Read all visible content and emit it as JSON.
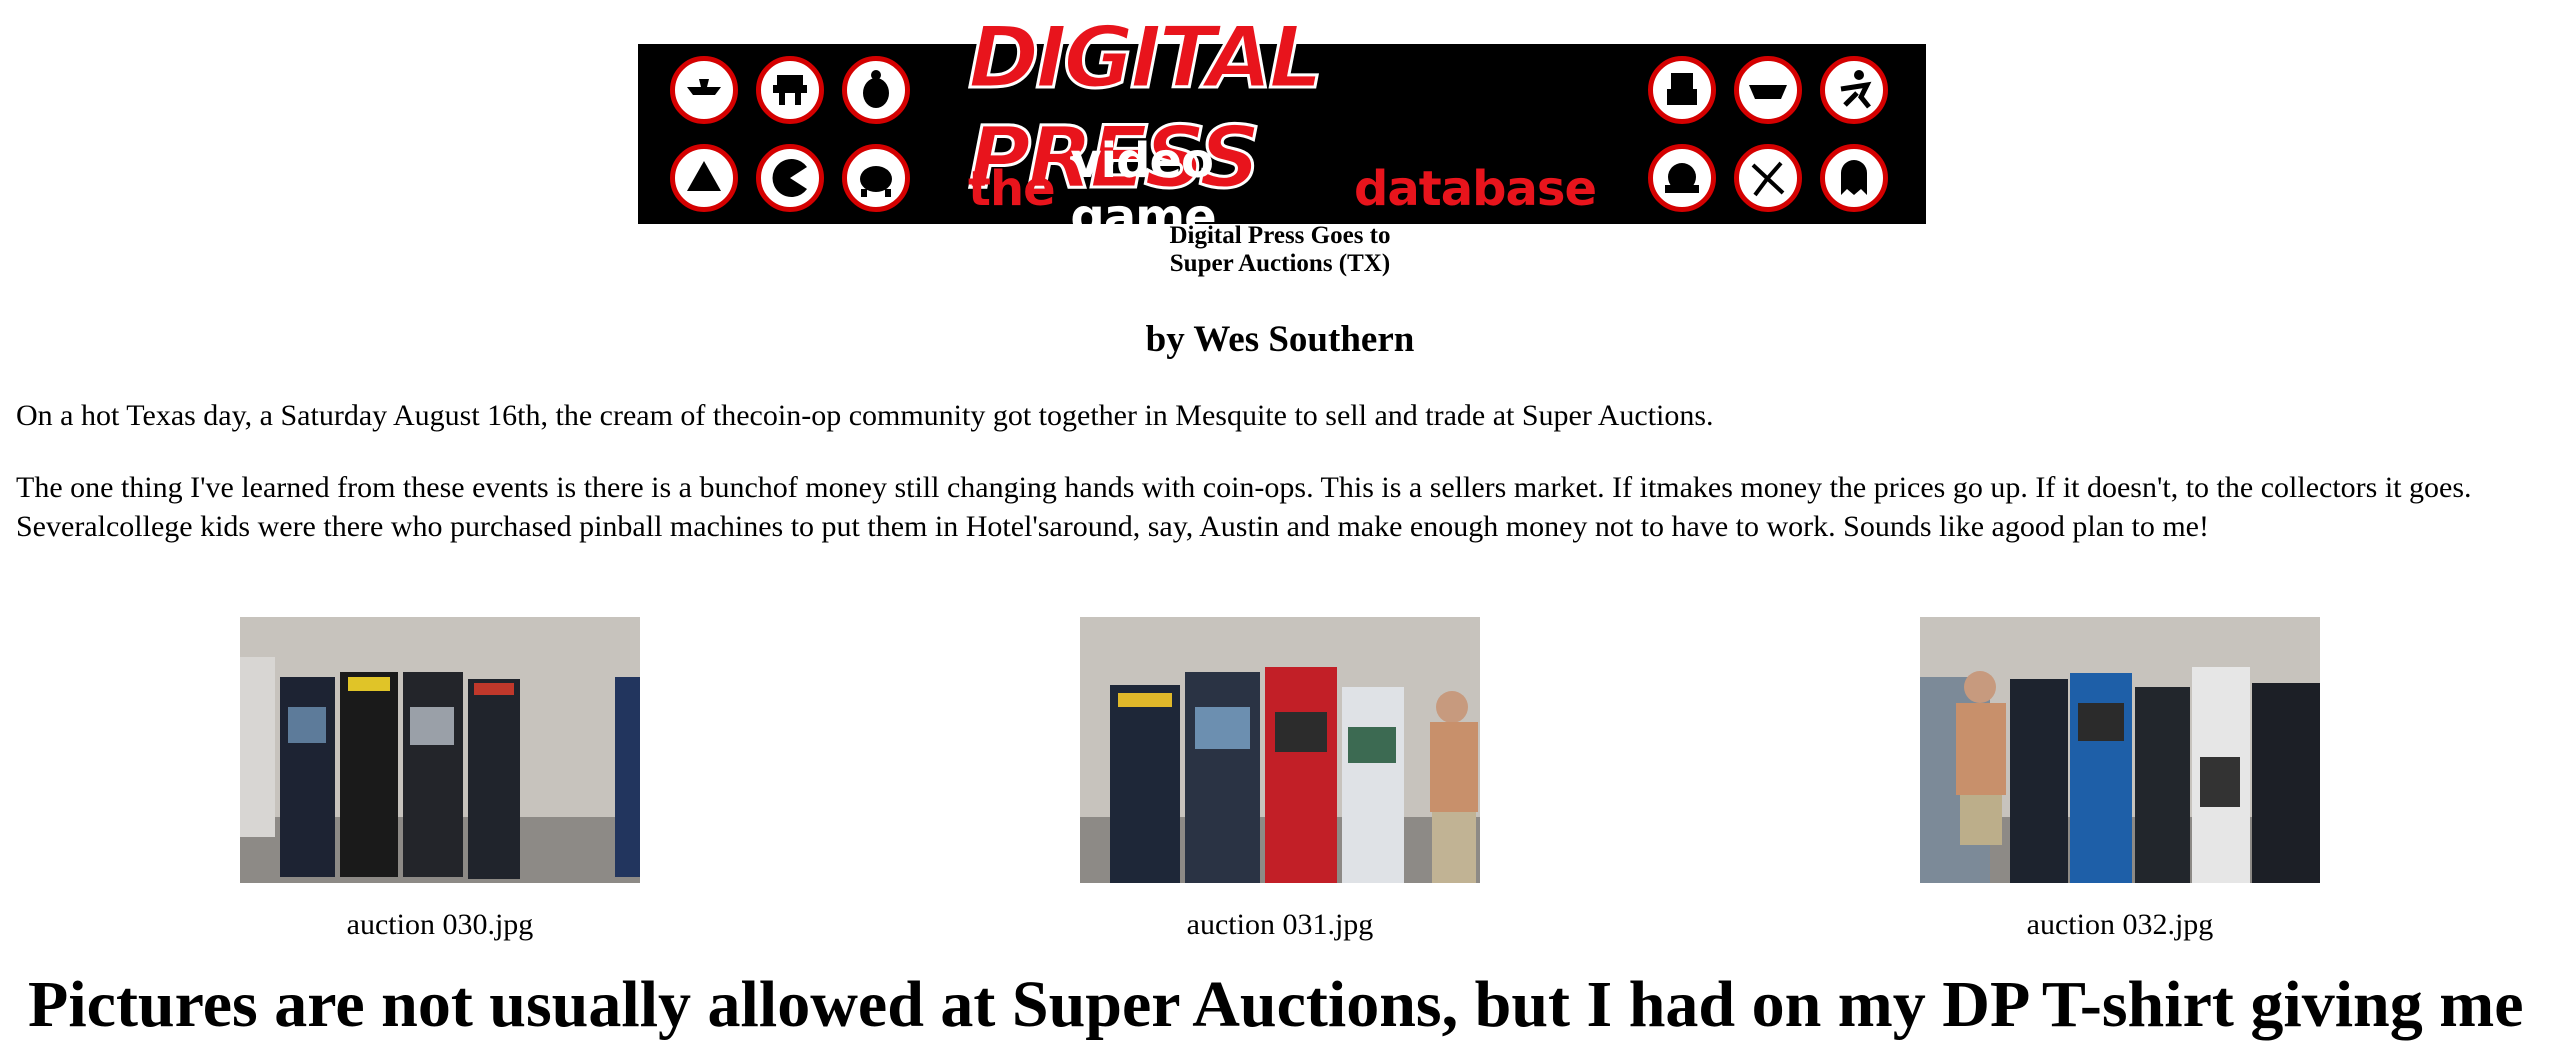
{
  "banner": {
    "logo_main": "DIGITAL PRESS",
    "logo_sub_the": "the",
    "logo_sub_video_game": "video game",
    "logo_sub_database": "database",
    "accent_red": "#e8141c"
  },
  "article": {
    "title_line1": "Digital Press Goes to",
    "title_line2": "Super Auctions (TX)",
    "byline": "by Wes Southern",
    "paragraph1": "On a hot Texas day, a Saturday August 16th, the cream of thecoin-op community got together in Mesquite to sell and trade at Super Auctions.",
    "paragraph2": "The one thing I've learned from these events is there is a bunchof money still changing hands with coin-ops. This is a sellers market. If itmakes money the prices go up. If it doesn't, to the collectors it goes. Severalcollege kids were there who purchased pinball machines to put them in Hotel'saround, say, Austin and make enough money not to have to work. Sounds like agood plan to me!",
    "big_text": "Pictures are not usually allowed at Super Auctions, but I had on my DP T-shirt giving me"
  },
  "photos": [
    {
      "caption": "auction 030.jpg"
    },
    {
      "caption": "auction 031.jpg"
    },
    {
      "caption": "auction 032.jpg"
    }
  ]
}
